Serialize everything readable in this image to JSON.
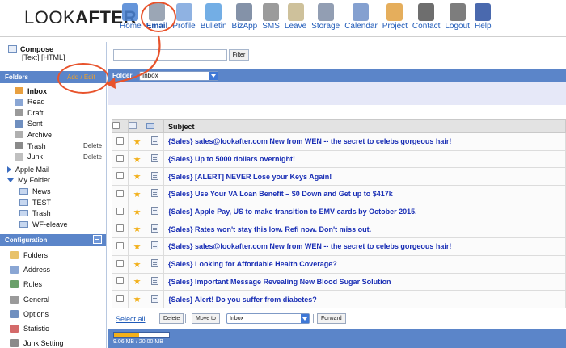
{
  "app": {
    "logo_light": "LOOK",
    "logo_bold": "AFTER"
  },
  "nav": [
    {
      "label": "Home",
      "icon": "home-icon",
      "color": "#4a82d4"
    },
    {
      "label": "Email",
      "icon": "email-icon",
      "color": "#8a96a8",
      "active": true
    },
    {
      "label": "Profile",
      "icon": "profile-icon",
      "color": "#7ba4dd"
    },
    {
      "label": "Bulletin",
      "icon": "bulletin-icon",
      "color": "#5aa0e0"
    },
    {
      "label": "BizApp",
      "icon": "bizapp-icon",
      "color": "#6e7f99"
    },
    {
      "label": "SMS",
      "icon": "sms-icon",
      "color": "#8a8a8a"
    },
    {
      "label": "Leave",
      "icon": "leave-icon",
      "color": "#c6b68a"
    },
    {
      "label": "Storage",
      "icon": "storage-icon",
      "color": "#7f8da6"
    },
    {
      "label": "Calendar",
      "icon": "calendar-icon",
      "color": "#6e8fc8"
    },
    {
      "label": "Project",
      "icon": "project-icon",
      "color": "#e0a040"
    },
    {
      "label": "Contact",
      "icon": "contact-icon",
      "color": "#555555"
    },
    {
      "label": "Logout",
      "icon": "logout-icon",
      "color": "#666666"
    },
    {
      "label": "Help",
      "icon": "help-icon",
      "color": "#2a4fa0"
    }
  ],
  "compose": {
    "title": "Compose",
    "options": "[Text] [HTML]"
  },
  "folders": {
    "heading": "Folders",
    "add_edit": "Add / Edit",
    "system": [
      {
        "label": "Inbox",
        "bold": true
      },
      {
        "label": "Read"
      },
      {
        "label": "Draft"
      },
      {
        "label": "Sent"
      },
      {
        "label": "Archive"
      },
      {
        "label": "Trash",
        "delete_label": "Delete"
      },
      {
        "label": "Junk",
        "delete_label": "Delete"
      }
    ],
    "apple_mail": "Apple Mail",
    "my_folder": "My Folder",
    "my_folder_items": [
      "News",
      "TEST",
      "Trash",
      "WF-eleave"
    ]
  },
  "configuration": {
    "heading": "Configuration",
    "items": [
      {
        "label": "Folders",
        "icon_color": "#e8c26a"
      },
      {
        "label": "Address",
        "icon_color": "#8aa6d4"
      },
      {
        "label": "Rules",
        "icon_color": "#6aa06a"
      },
      {
        "label": "General",
        "icon_color": "#9a9a9a"
      },
      {
        "label": "Options",
        "icon_color": "#6f8fbf"
      },
      {
        "label": "Statistic",
        "icon_color": "#d46a6a"
      },
      {
        "label": "Junk Setting",
        "icon_color": "#8a8a8a"
      }
    ]
  },
  "search": {
    "value": "",
    "filter_label": "Filter"
  },
  "folder_bar": {
    "label": "Folder",
    "selected": "Inbox"
  },
  "table": {
    "subject_header": "Subject",
    "rows": [
      "{Sales} sales@lookafter.com New from WEN -- the secret to celebs gorgeous hair!",
      "{Sales} Up to 5000 dollars overnight!",
      "{Sales} [ALERT] NEVER Lose your Keys Again!",
      "{Sales} Use Your VA Loan Benefit – $0 Down and Get up to $417k",
      "{Sales} Apple Pay, US to make transition to EMV cards by October 2015.",
      "{Sales} Rates won't stay this low. Refi now. Don't miss out.",
      "{Sales} sales@lookafter.com New from WEN -- the secret to celebs gorgeous hair!",
      "{Sales} Looking for Affordable Health Coverage?",
      "{Sales} Important Message Revealing New Blood Sugar Solution",
      "{Sales} Alert! Do you suffer from diabetes?"
    ]
  },
  "bottom": {
    "select_all": "Select all",
    "delete": "Delete",
    "move_to": "Move to",
    "move_target": "Inbox",
    "forward": "Forward"
  },
  "quota": {
    "text": "9.06 MB / 20.00 MB",
    "fraction": 0.453
  },
  "colors": {
    "annotation": "#e8532c",
    "header_blue": "#5b85c9",
    "link_blue": "#1a2fb5",
    "star": "#f2b01a"
  }
}
